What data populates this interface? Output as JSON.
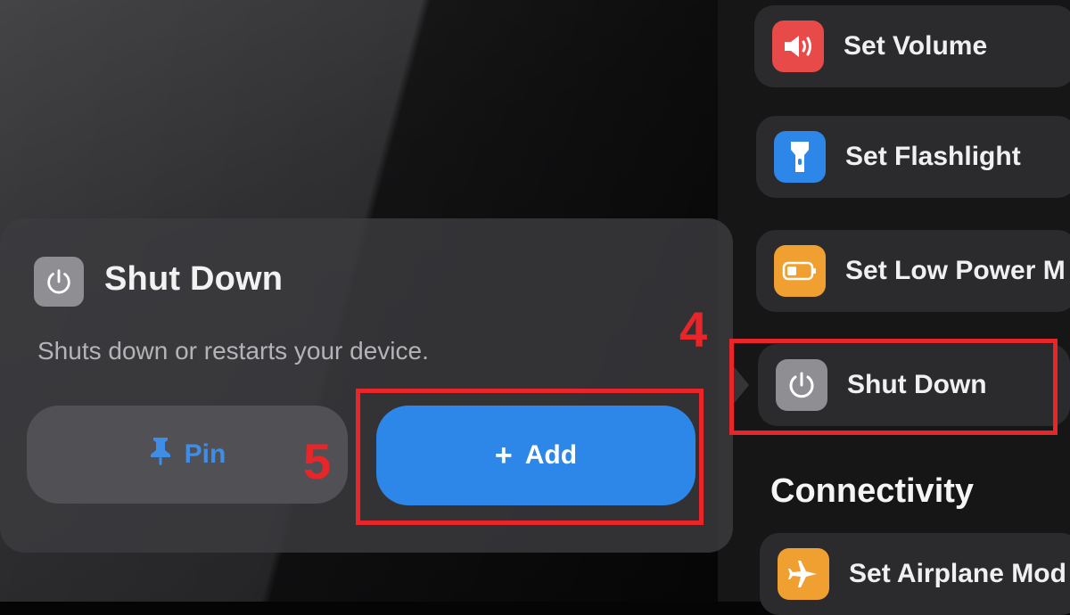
{
  "popover": {
    "title": "Shut Down",
    "description": "Shuts down or restarts your device.",
    "pin_label": "Pin",
    "add_label": "Add",
    "add_symbol": "+"
  },
  "annotations": {
    "step_4": "4",
    "step_5": "5",
    "highlight_color": "#e8262a"
  },
  "controls": [
    {
      "label": "Set Volume",
      "icon": "speaker-icon",
      "color": "#e84a4a"
    },
    {
      "label": "Set Flashlight",
      "icon": "flashlight-icon",
      "color": "#2d87e8"
    },
    {
      "label": "Set Low Power M",
      "icon": "battery-icon",
      "color": "#f0a030"
    },
    {
      "label": "Shut Down",
      "icon": "power-icon",
      "color": "#8e8e93"
    }
  ],
  "connectivity": {
    "heading": "Connectivity",
    "items": [
      {
        "label": "Set Airplane Mod",
        "icon": "airplane-icon",
        "color": "#f0a030"
      }
    ]
  }
}
